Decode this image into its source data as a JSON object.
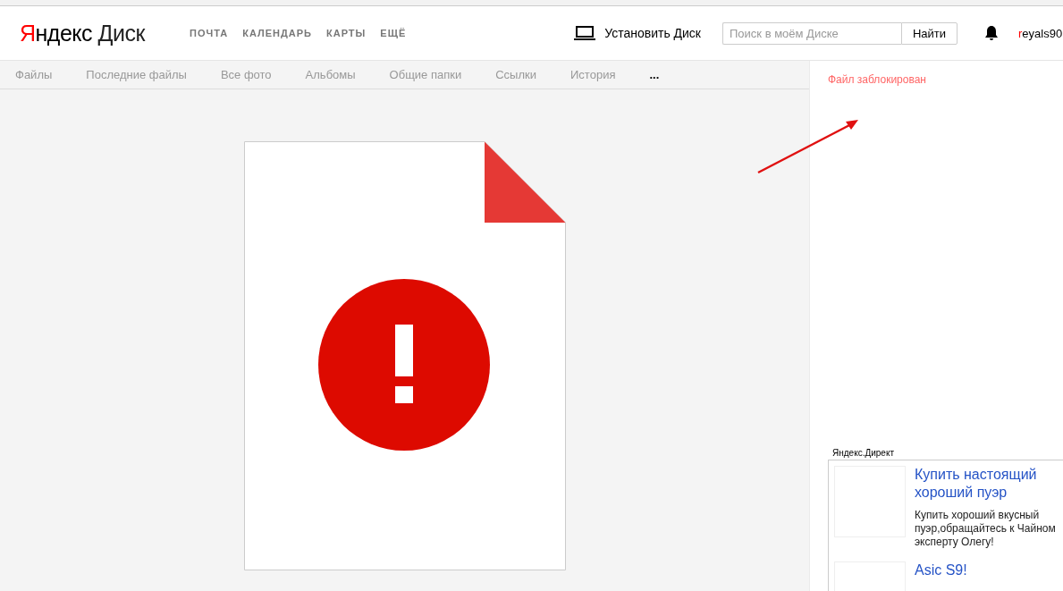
{
  "logo": {
    "initial": "Я",
    "rest": "ндекс",
    "product": "Диск"
  },
  "services": [
    "ПОЧТА",
    "КАЛЕНДАРЬ",
    "КАРТЫ",
    "ЕЩЁ"
  ],
  "install": {
    "label": "Установить Диск"
  },
  "search": {
    "placeholder": "Поиск в моём Диске",
    "button": "Найти"
  },
  "user": {
    "initial": "r",
    "rest": "eyals90"
  },
  "tabs": [
    {
      "label": "Файлы",
      "kind": "link"
    },
    {
      "label": "Последние файлы",
      "kind": "link"
    },
    {
      "label": "Все фото",
      "kind": "link"
    },
    {
      "label": "Альбомы",
      "kind": "link"
    },
    {
      "label": "Общие папки",
      "kind": "link"
    },
    {
      "label": "Ссылки",
      "kind": "link"
    },
    {
      "label": "История",
      "kind": "link"
    },
    {
      "label": "...",
      "kind": "more"
    }
  ],
  "side": {
    "message": "Файл заблокирован"
  },
  "ads": {
    "title": "Яндекс.Директ",
    "items": [
      {
        "heading": "Купить настоящий хороший пуэр",
        "lines": [
          "Купить хороший вкусный",
          "пуэр,обращайтесь к Чайном",
          "эксперту Олегу!"
        ]
      },
      {
        "heading": "Asic S9!"
      }
    ]
  }
}
